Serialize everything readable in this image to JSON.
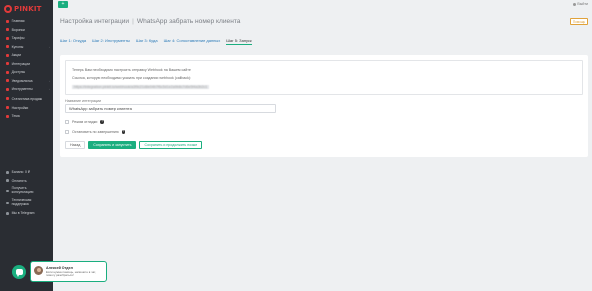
{
  "brand": {
    "name": "PINKIT"
  },
  "sidebar": {
    "items": [
      {
        "label": "Главная"
      },
      {
        "label": "Воронки"
      },
      {
        "label": "Тарифы"
      },
      {
        "label": "Купоны"
      },
      {
        "label": "Акции"
      },
      {
        "label": "Интеграции"
      },
      {
        "label": "Доступы"
      },
      {
        "label": "Уведомлялка"
      },
      {
        "label": "Инструменты"
      },
      {
        "label": "Статистика продаж"
      },
      {
        "label": "Настройки"
      },
      {
        "label": "Тема"
      }
    ],
    "bottom_items": [
      {
        "label": "Баланс: 0 ₽"
      },
      {
        "label": "Оплатить"
      },
      {
        "label": "Получить консультацию"
      },
      {
        "label": "Техническая поддержка"
      },
      {
        "label": "Мы в Telegram"
      }
    ]
  },
  "topbar": {
    "add_label": "+",
    "user_label": "Выйти"
  },
  "header": {
    "section_title": "Настройка интеграции",
    "integration_title": "WhatsApp забрать номер клиента",
    "help_label": "Помощь"
  },
  "tabs": [
    {
      "label": "Шаг 1: Откуда"
    },
    {
      "label": "Шаг 2: Инструменты"
    },
    {
      "label": "Шаг 3: Куда"
    },
    {
      "label": "Шаг 4: Сопоставление данных"
    },
    {
      "label": "Шаг 5: Запуск"
    }
  ],
  "active_tab": 4,
  "info": {
    "line1": "Теперь Вам необходимо настроить отправку Webhook на Вашем сайте",
    "line2": "Ссылка, которую необходимо указать при создании webhook (callback):",
    "webhook_url": "https://integration.pinkit.io/webhook/a3f9c21d8e04b7f6c5d1e2a9b8c7d6e5f4a3b2c1"
  },
  "form": {
    "name_label": "Название интеграции",
    "name_value": "WhatsApp забрать номер клиента",
    "checkbox1_label": "Режим отладки",
    "checkbox2_label": "Остановить по завершению"
  },
  "buttons": {
    "back": "Назад",
    "save_exit": "Сохранить и запустить",
    "save_continue": "Сохранить и продолжить позже"
  },
  "chat": {
    "name": "Алексей Отдел",
    "message": "Если нужна помощь, напишите в чат, помогу разобраться!"
  },
  "colors": {
    "sidebar_bg": "#2a2d33",
    "accent_green": "#1aae7f",
    "brand_red": "#e23a3a",
    "link_blue": "#2a7ab8",
    "help_orange": "#e0a23a"
  }
}
